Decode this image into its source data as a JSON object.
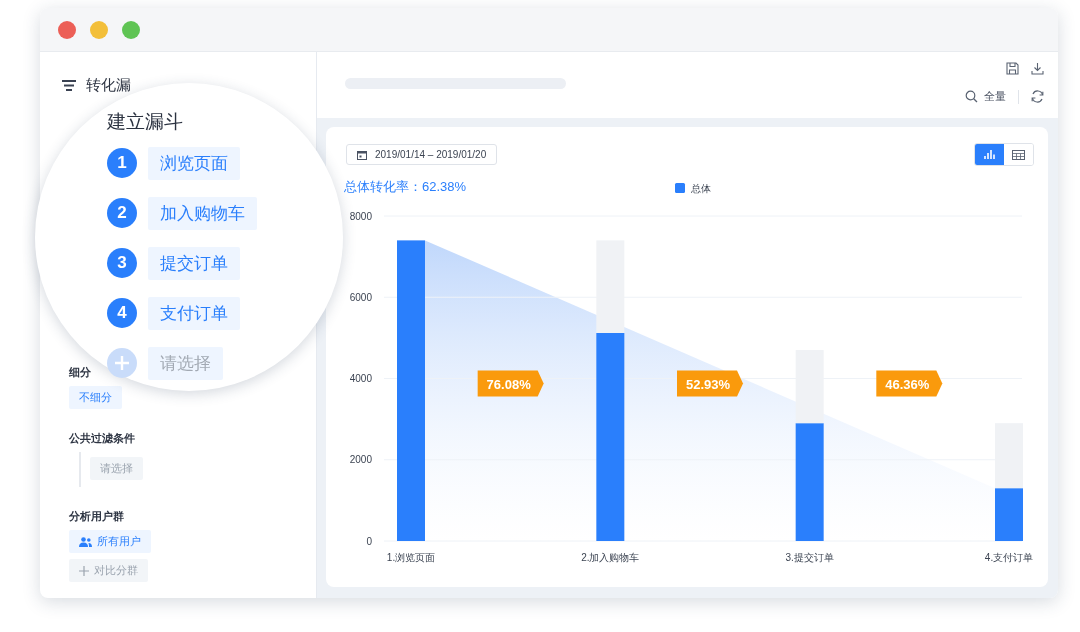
{
  "window": {
    "controls": [
      {
        "color": "#ec5f57"
      },
      {
        "color": "#f3bf3a"
      },
      {
        "color": "#5fc454"
      }
    ]
  },
  "sidebar": {
    "title": "转化漏",
    "funnel": {
      "title": "建立漏斗",
      "steps": [
        {
          "number": "1",
          "label": "浏览页面"
        },
        {
          "number": "2",
          "label": "加入购物车"
        },
        {
          "number": "3",
          "label": "提交订单"
        },
        {
          "number": "4",
          "label": "支付订单"
        }
      ],
      "add": {
        "placeholder": "请选择"
      }
    },
    "breakdown": {
      "label": "细分",
      "value": "不细分"
    },
    "filter": {
      "label": "公共过滤条件",
      "placeholder": "请选择"
    },
    "groups": {
      "label": "分析用户群",
      "items": [
        {
          "kind": "group",
          "label": "所有用户"
        },
        {
          "kind": "add",
          "label": "对比分群"
        }
      ]
    }
  },
  "toolbar": {
    "scope": "全量"
  },
  "card": {
    "date_range": "2019/01/14 – 2019/01/20",
    "views": [
      {
        "kind": "chart",
        "selected": true
      },
      {
        "kind": "table",
        "selected": false
      }
    ],
    "rate_label": "总体转化率：62.38%",
    "chart_data": {
      "type": "bar",
      "categories": [
        "1.浏览页面",
        "2.加入购物车",
        "3.提交订单",
        "4.支付订单"
      ],
      "series": [
        {
          "name": "总体",
          "color": "#2a7ffc",
          "values": [
            7400,
            5120,
            2900,
            1300
          ]
        },
        {
          "color": "#f0f2f5",
          "values": [
            null,
            2280,
            1800,
            1600
          ]
        }
      ],
      "stacked": true,
      "grid": true,
      "ylim": [
        0,
        8000
      ],
      "yticks": [
        0,
        2000,
        4000,
        6000,
        8000
      ],
      "annotations": [
        {
          "text": "76.08%"
        },
        {
          "text": "52.93%"
        },
        {
          "text": "46.36%"
        }
      ]
    }
  }
}
